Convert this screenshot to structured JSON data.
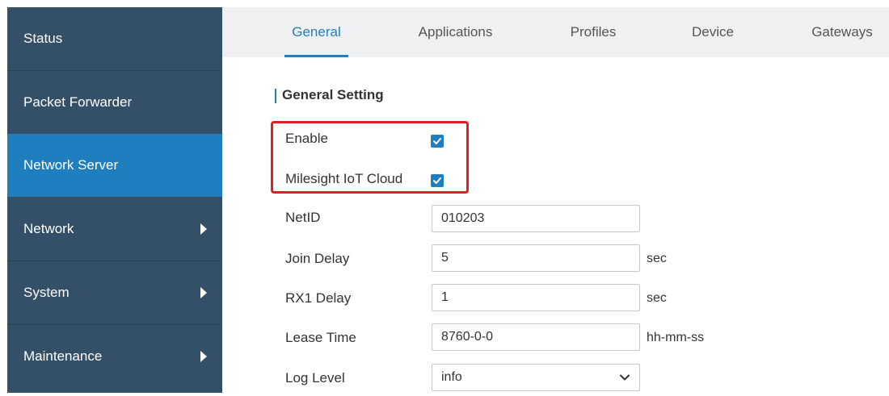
{
  "sidebar": {
    "items": [
      {
        "label": "Status",
        "active": false,
        "has_arrow": false
      },
      {
        "label": "Packet Forwarder",
        "active": false,
        "has_arrow": false
      },
      {
        "label": "Network Server",
        "active": true,
        "has_arrow": false
      },
      {
        "label": "Network",
        "active": false,
        "has_arrow": true
      },
      {
        "label": "System",
        "active": false,
        "has_arrow": true
      },
      {
        "label": "Maintenance",
        "active": false,
        "has_arrow": true
      }
    ]
  },
  "tabs": [
    {
      "label": "General",
      "active": true
    },
    {
      "label": "Applications",
      "active": false
    },
    {
      "label": "Profiles",
      "active": false
    },
    {
      "label": "Device",
      "active": false
    },
    {
      "label": "Gateways",
      "active": false
    }
  ],
  "section": {
    "title": "General Setting"
  },
  "form": {
    "enable": {
      "label": "Enable",
      "checked": true
    },
    "milesight_cloud": {
      "label": "Milesight IoT Cloud",
      "checked": true
    },
    "netid": {
      "label": "NetID",
      "value": "010203"
    },
    "join_delay": {
      "label": "Join Delay",
      "value": "5",
      "unit": "sec"
    },
    "rx1_delay": {
      "label": "RX1 Delay",
      "value": "1",
      "unit": "sec"
    },
    "lease_time": {
      "label": "Lease Time",
      "value": "8760-0-0",
      "unit": "hh-mm-ss"
    },
    "log_level": {
      "label": "Log Level",
      "value": "info"
    }
  },
  "colors": {
    "sidebar": "#345068",
    "active": "#1f7fbe",
    "highlight": "#e0201c"
  }
}
